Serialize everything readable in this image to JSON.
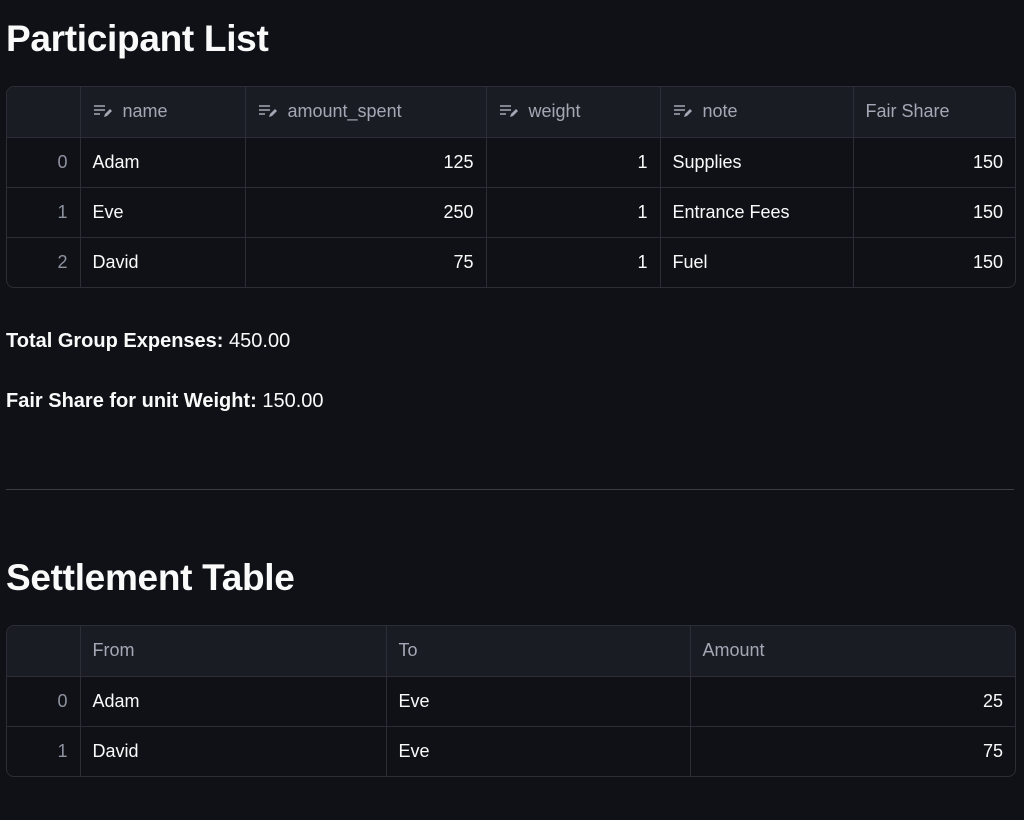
{
  "participants": {
    "title": "Participant List",
    "columns": [
      {
        "label": "name",
        "editable": true,
        "icon": "edit-text-icon"
      },
      {
        "label": "amount_spent",
        "editable": true,
        "icon": "edit-text-icon"
      },
      {
        "label": "weight",
        "editable": true,
        "icon": "edit-text-icon"
      },
      {
        "label": "note",
        "editable": true,
        "icon": "edit-text-icon"
      },
      {
        "label": "Fair Share",
        "editable": false
      }
    ],
    "rows": [
      {
        "index": "0",
        "name": "Adam",
        "amount_spent": "125",
        "weight": "1",
        "note": "Supplies",
        "fair_share": "150"
      },
      {
        "index": "1",
        "name": "Eve",
        "amount_spent": "250",
        "weight": "1",
        "note": "Entrance Fees",
        "fair_share": "150"
      },
      {
        "index": "2",
        "name": "David",
        "amount_spent": "75",
        "weight": "1",
        "note": "Fuel",
        "fair_share": "150"
      }
    ]
  },
  "summary": {
    "total_label": "Total Group Expenses:",
    "total_value": "450.00",
    "fair_label": "Fair Share for unit Weight:",
    "fair_value": "150.00"
  },
  "settlement": {
    "title": "Settlement Table",
    "columns": [
      {
        "label": "From"
      },
      {
        "label": "To"
      },
      {
        "label": "Amount"
      }
    ],
    "rows": [
      {
        "index": "0",
        "from": "Adam",
        "to": "Eve",
        "amount": "25"
      },
      {
        "index": "1",
        "from": "David",
        "to": "Eve",
        "amount": "75"
      }
    ]
  },
  "colors": {
    "background": "#0f1117",
    "text": "#fafafa",
    "header_bg": "#1a1c24",
    "border": "#2b2e36"
  }
}
